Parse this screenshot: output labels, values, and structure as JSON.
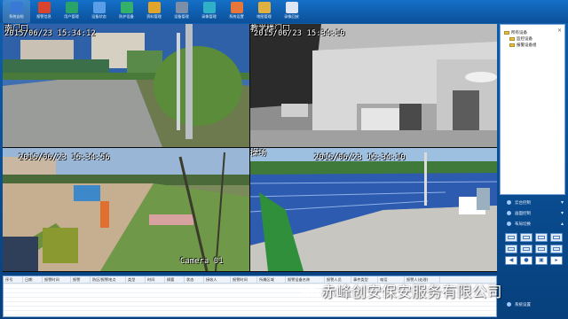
{
  "toolbar": {
    "items": [
      {
        "label": "系统自检",
        "icon": "monitor-icon",
        "color": "#3a78d6"
      },
      {
        "label": "报警信息",
        "icon": "alarm-icon",
        "color": "#d9442e"
      },
      {
        "label": "用户管理",
        "icon": "users-icon",
        "color": "#2aa36b"
      },
      {
        "label": "设备状态",
        "icon": "device-icon",
        "color": "#5a9ee8"
      },
      {
        "label": "防护设备",
        "icon": "shield-icon",
        "color": "#33b06a"
      },
      {
        "label": "资料管理",
        "icon": "archive-icon",
        "color": "#e0a52a"
      },
      {
        "label": "设备管理",
        "icon": "settings-icon",
        "color": "#7d8fa8"
      },
      {
        "label": "录像管理",
        "icon": "record-icon",
        "color": "#2fb0c8"
      },
      {
        "label": "系统设置",
        "icon": "gear-icon",
        "color": "#e6763a"
      },
      {
        "label": "地图管理",
        "icon": "map-icon",
        "color": "#e0b040"
      },
      {
        "label": "录像回放",
        "icon": "playback-icon",
        "color": "#dde6f2"
      }
    ]
  },
  "cameras": [
    {
      "id": "cam-1",
      "title": "南门口",
      "timestamp": "2015/06/23 15:34:12",
      "name": ""
    },
    {
      "id": "cam-2",
      "title": "教学楼门口",
      "timestamp": "2015/06/23 15:34:10",
      "name": ""
    },
    {
      "id": "cam-3",
      "title": "",
      "timestamp": "2015/06/23 15:34:56",
      "name": "Camera 01"
    },
    {
      "id": "cam-4",
      "title": "操场",
      "timestamp": "2015/06/23 15:34:10",
      "name": ""
    }
  ],
  "tree": {
    "root": "所有设备",
    "children": [
      "监控设备",
      "报警设备组"
    ]
  },
  "panel": {
    "buttons": [
      {
        "label": "云台控制",
        "caret": "▾"
      },
      {
        "label": "画面控制",
        "caret": "▾"
      },
      {
        "label": "布局切换",
        "caret": "▴"
      }
    ],
    "system_label": "系统设置",
    "control_icons": [
      "speaker-icon",
      "snapshot-icon",
      "fullscreen-icon",
      "exit-icon"
    ]
  },
  "log": {
    "columns": [
      "序号",
      "日期",
      "报警时间",
      "报警",
      "防区/报警地点",
      "类型",
      "时间",
      "摘要",
      "状态",
      "接收人",
      "报警时间",
      "所属区域",
      "报警设备名称",
      "报警人员",
      "事件类型",
      "电话",
      "报警人(处理)"
    ]
  },
  "watermark": {
    "text": "赤峰创安保安服务有限公司"
  },
  "colors": {
    "app_bg": "#0a4a8a",
    "toolbar_bg": "#1470c8",
    "panel_bg": "#07407c"
  }
}
